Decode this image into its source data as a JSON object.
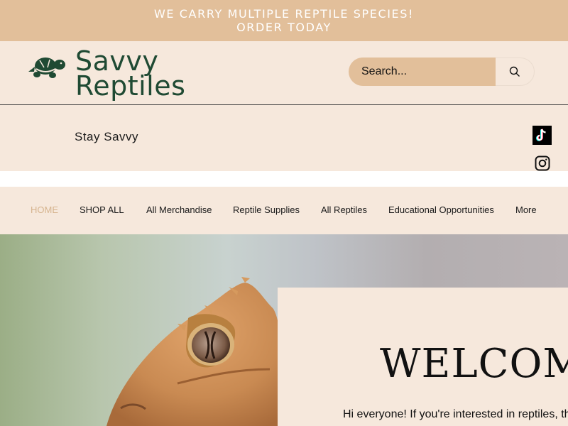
{
  "banner": {
    "line1": "WE CARRY MULTIPLE REPTILE SPECIES!",
    "line2": "ORDER TODAY"
  },
  "header": {
    "brand_line1": "Savvy",
    "brand_line2": "Reptiles",
    "logo_icon": "turtle-icon",
    "search": {
      "placeholder": "Search...",
      "icon": "search-icon"
    }
  },
  "subheader": {
    "tagline": "Stay Savvy",
    "social": [
      "tiktok-icon",
      "instagram-icon"
    ]
  },
  "nav": {
    "items": [
      {
        "label": "HOME",
        "active": true
      },
      {
        "label": "SHOP ALL"
      },
      {
        "label": "All Merchandise"
      },
      {
        "label": "Reptile Supplies"
      },
      {
        "label": "All Reptiles"
      },
      {
        "label": "Educational Opportunities"
      },
      {
        "label": "More"
      }
    ]
  },
  "hero": {
    "title": "WELCOM",
    "text": "Hi everyone! If you're interested in reptiles, th"
  },
  "colors": {
    "banner_bg": "#e2bf9a",
    "page_bg": "#f6e8dc",
    "brand_green": "#1f4a33",
    "nav_active": "#d6b48f"
  }
}
